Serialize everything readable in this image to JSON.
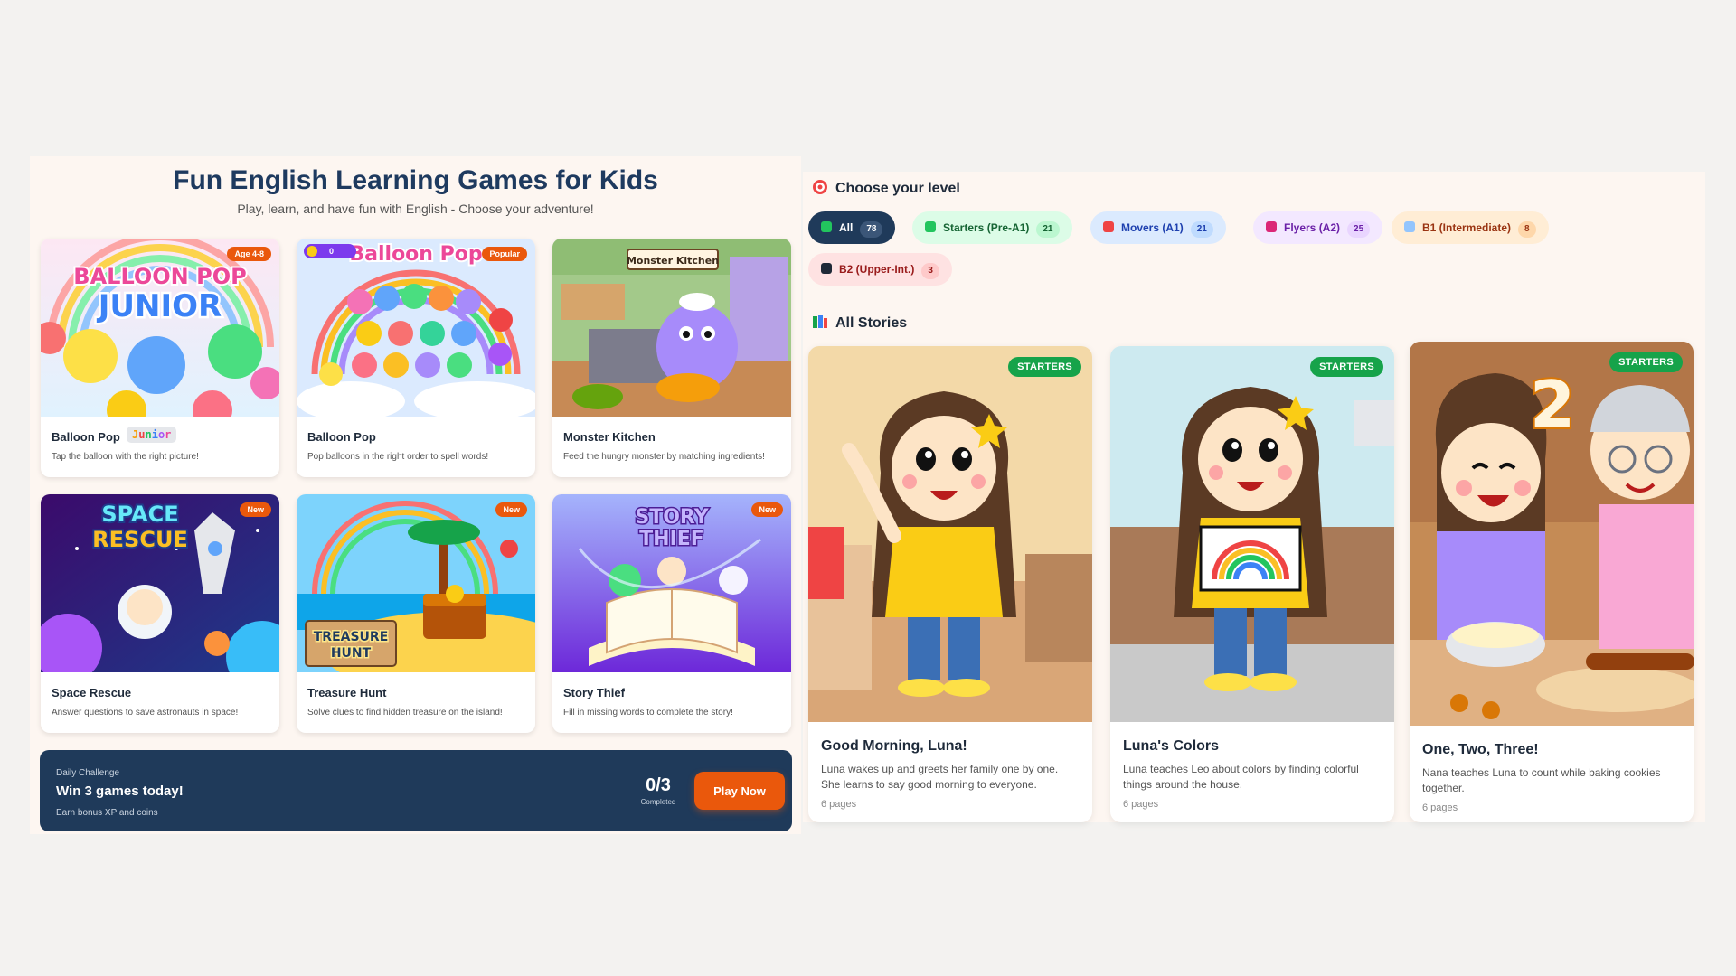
{
  "games_section": {
    "title": "Fun English Learning Games for Kids",
    "subtitle": "Play, learn, and have fun with English - Choose your adventure!",
    "games": [
      {
        "name": "Balloon Pop",
        "tag": "Junior",
        "badge": "Age 4-8",
        "description": "Tap the balloon with the right picture!",
        "art_text": "BALLOON POP JUNIOR"
      },
      {
        "name": "Balloon Pop",
        "badge": "Popular",
        "coins": "0",
        "description": "Pop balloons in the right order to spell words!",
        "art_text": "Balloon Pop"
      },
      {
        "name": "Monster Kitchen",
        "description": "Feed the hungry monster by matching ingredients!",
        "art_text": "Monster Kitchen"
      },
      {
        "name": "Space Rescue",
        "badge": "New",
        "description": "Answer questions to save astronauts in space!",
        "art_text": "SPACE RESCUE"
      },
      {
        "name": "Treasure Hunt",
        "badge": "New",
        "description": "Solve clues to find hidden treasure on the island!",
        "art_text": "TREASURE HUNT"
      },
      {
        "name": "Story Thief",
        "badge": "New",
        "description": "Fill in missing words to complete the story!",
        "art_text": "STORY THIEF"
      }
    ],
    "daily_challenge": {
      "eyebrow": "Daily Challenge",
      "title": "Win 3 games today!",
      "subtitle": "Earn bonus XP and coins",
      "progress_value": "0/3",
      "progress_label": "Completed",
      "button_label": "Play Now"
    }
  },
  "stories_section": {
    "level_heading": "Choose your level",
    "levels": [
      {
        "label": "All",
        "count": "78",
        "active": true,
        "bg": "#1f3a5a",
        "fg": "#ffffff",
        "count_bg": "#3b5678",
        "icon_color": "#22c55e"
      },
      {
        "label": "Starters (Pre-A1)",
        "count": "21",
        "bg": "#dcfce7",
        "fg": "#166534",
        "count_bg": "#bbf7d0",
        "icon_color": "#22c55e"
      },
      {
        "label": "Movers (A1)",
        "count": "21",
        "bg": "#dbeafe",
        "fg": "#1e40af",
        "count_bg": "#bfdbfe",
        "icon_color": "#ef4444"
      },
      {
        "label": "Flyers (A2)",
        "count": "25",
        "bg": "#f3e8ff",
        "fg": "#6b21a8",
        "count_bg": "#e9d5ff",
        "icon_color": "#db2777"
      },
      {
        "label": "B1 (Intermediate)",
        "count": "8",
        "bg": "#ffedd5",
        "fg": "#9a3412",
        "count_bg": "#fed7aa",
        "icon_color": "#93c5fd"
      },
      {
        "label": "B2 (Upper-Int.)",
        "count": "3",
        "bg": "#fee2e2",
        "fg": "#991b1b",
        "count_bg": "#fecaca",
        "icon_color": "#1f2937"
      }
    ],
    "stories_heading": "All Stories",
    "stories": [
      {
        "badge": "STARTERS",
        "title": "Good Morning, Luna!",
        "description": "Luna wakes up and greets her family one by one. She learns to say good morning to everyone.",
        "pages": "6 pages"
      },
      {
        "badge": "STARTERS",
        "title": "Luna's Colors",
        "description": "Luna teaches Leo about colors by finding colorful things around the house.",
        "pages": "6 pages"
      },
      {
        "badge": "STARTERS",
        "title": "One, Two, Three!",
        "description": "Nana teaches Luna to count while baking cookies together.",
        "pages": "6 pages",
        "art_number": "2"
      }
    ]
  }
}
